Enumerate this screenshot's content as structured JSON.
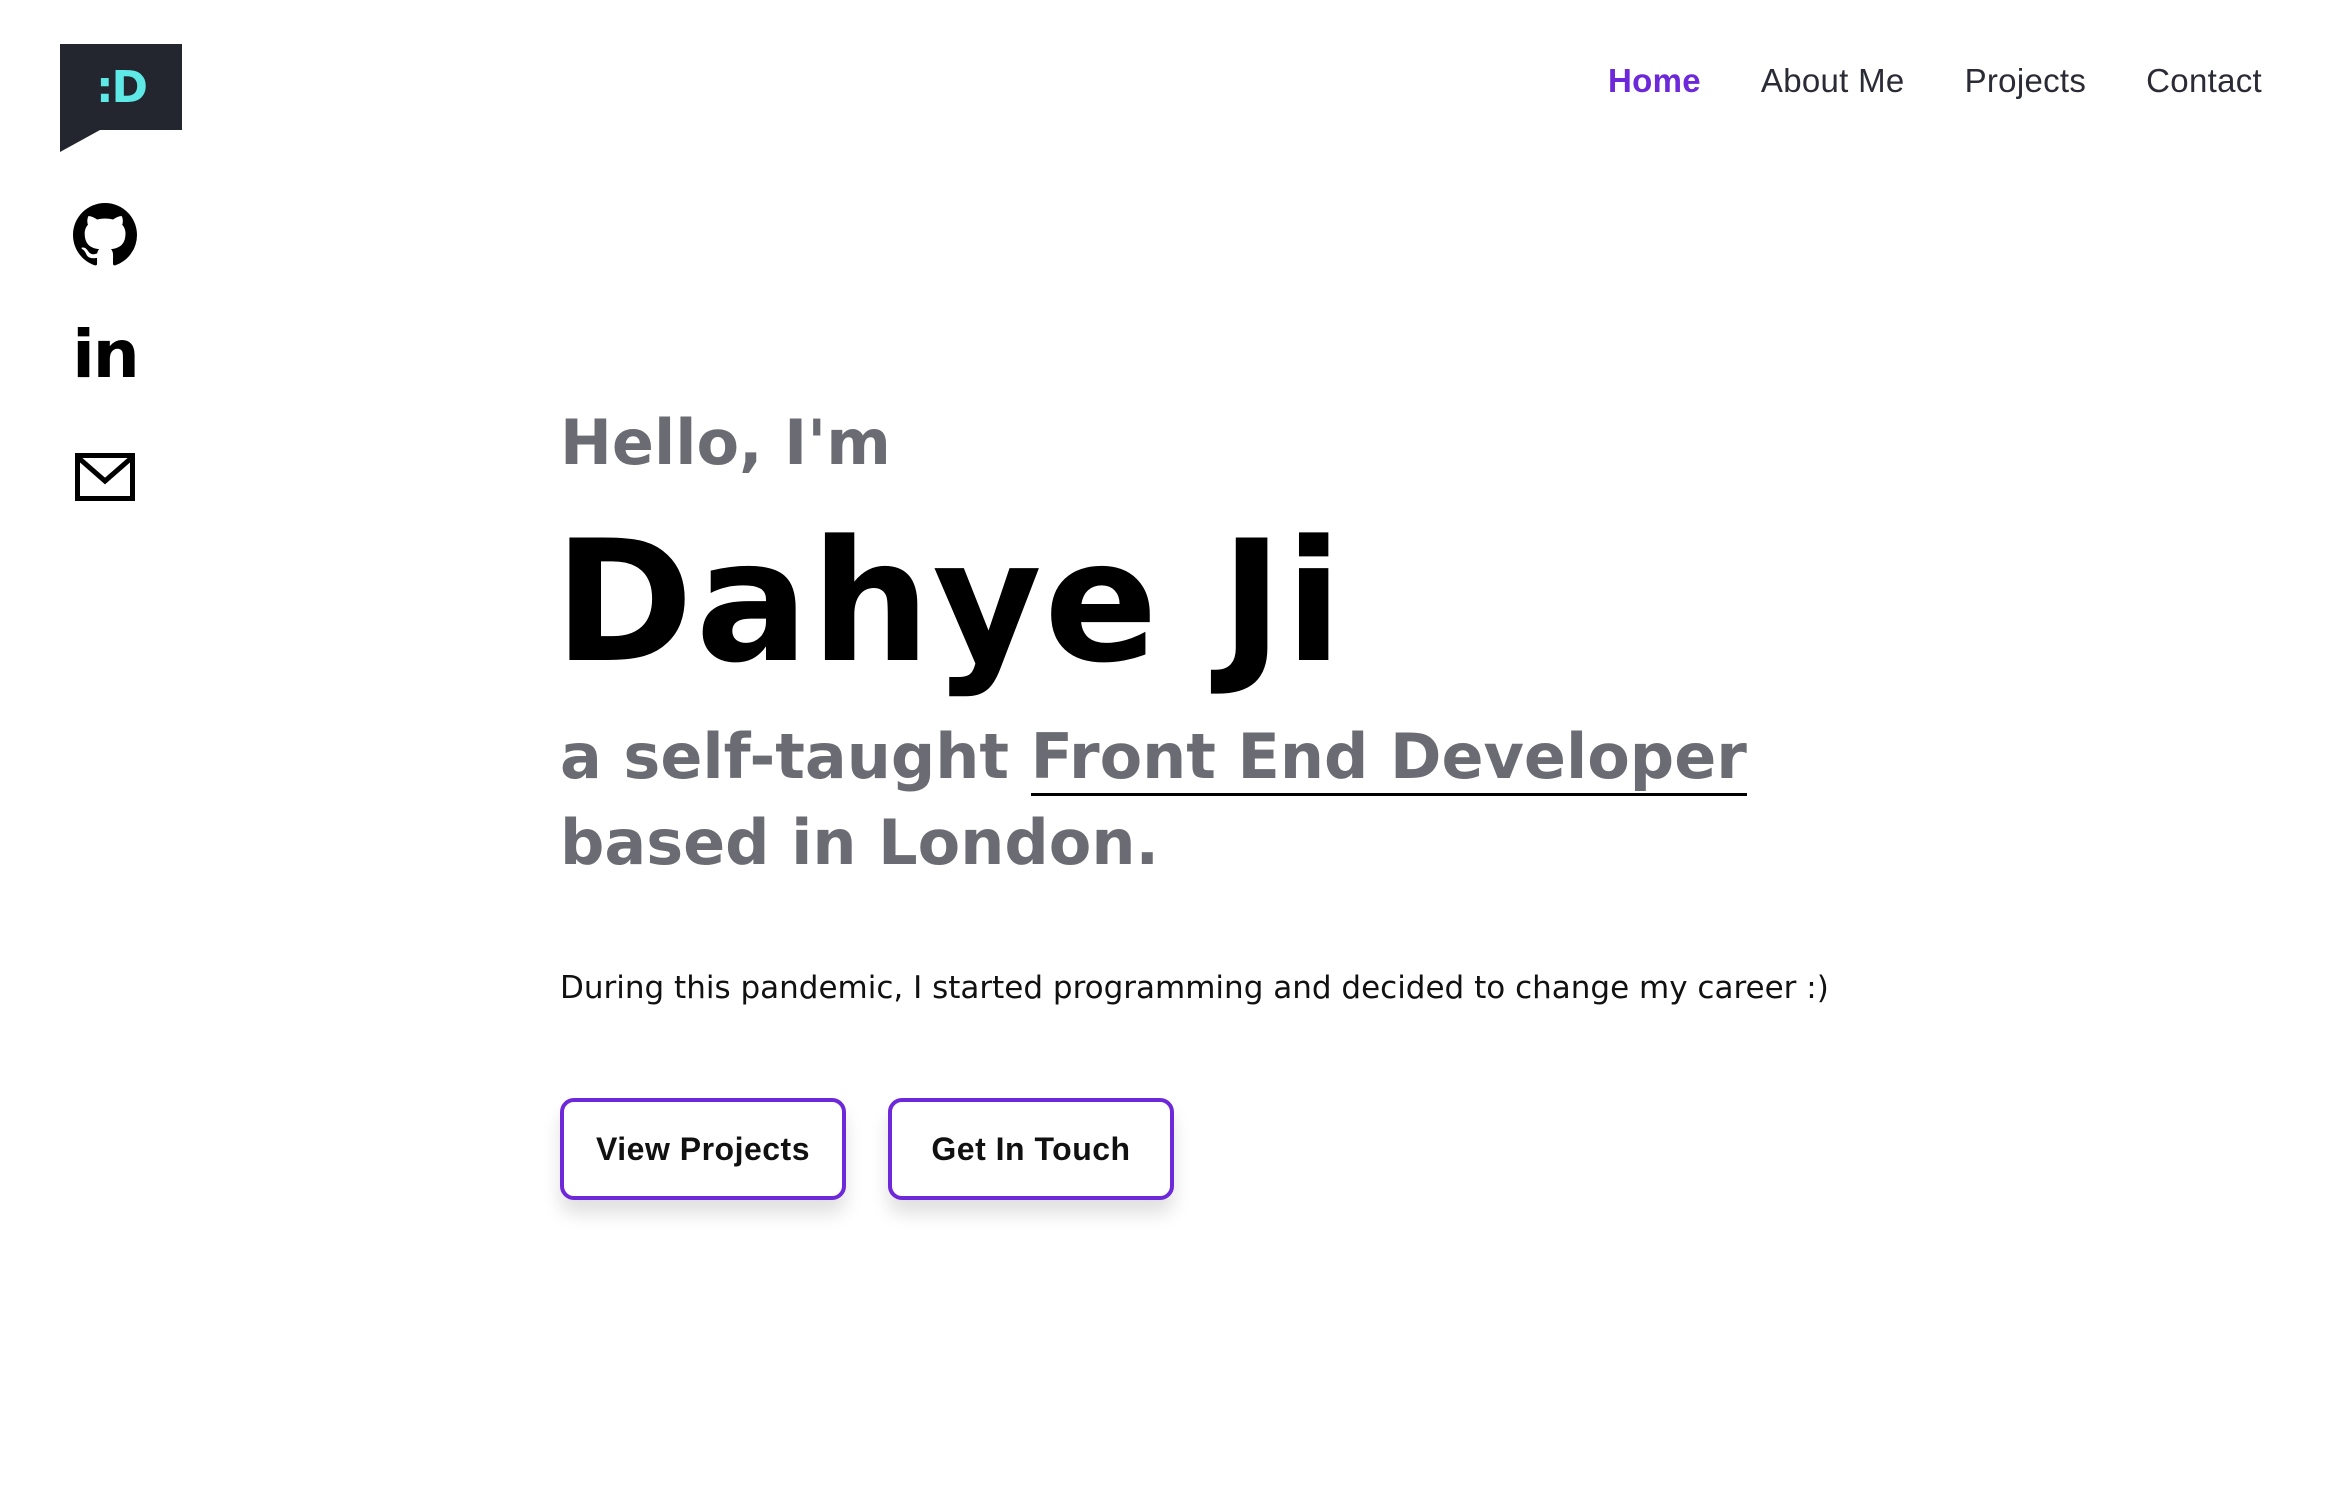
{
  "logo": {
    "text": ":D",
    "bg_color": "#23262f",
    "text_color": "#5ee9e6"
  },
  "social": {
    "github_icon": "github-icon",
    "linkedin_text": "in",
    "mail_icon": "mail-icon"
  },
  "nav": {
    "items": [
      {
        "label": "Home",
        "active": true
      },
      {
        "label": "About Me",
        "active": false
      },
      {
        "label": "Projects",
        "active": false
      },
      {
        "label": "Contact",
        "active": false
      }
    ],
    "accent_color": "#6d28d9"
  },
  "hero": {
    "greeting": "Hello, I'm",
    "name": "Dahye Ji",
    "tagline_prefix": "a self-taught ",
    "tagline_highlight": "Front End Developer",
    "tagline_suffix": "based in London.",
    "intro": "During this pandemic, I started programming and decided to change my career :)"
  },
  "buttons": {
    "view_projects": "View Projects",
    "get_in_touch": "Get In Touch"
  }
}
